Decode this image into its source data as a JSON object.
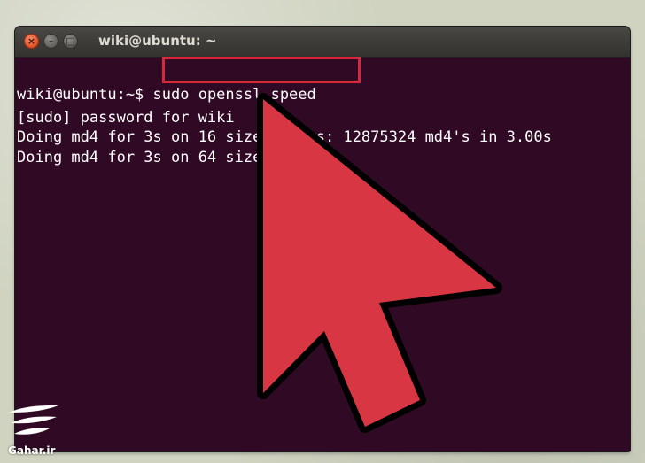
{
  "window": {
    "title": "wiki@ubuntu: ~",
    "close_glyph": "×",
    "minimize_glyph": "–",
    "maximize_glyph": "□"
  },
  "terminal": {
    "prompt": "wiki@ubuntu:~$ ",
    "command": "sudo openssl speed",
    "lines": [
      "[sudo] password for wiki",
      "Doing md4 for 3s on 16 size blocks: 12875324 md4's in 3.00s",
      "Doing md4 for 3s on 64 size blocks:"
    ]
  },
  "overlay": {
    "arrow_color": "#d93644",
    "highlight_color": "#d7283d",
    "arrow_icon": "mouse-pointer-arrow-icon"
  },
  "watermark": {
    "text": "Gahar.ir"
  },
  "colors": {
    "terminal_bg": "#300a24",
    "terminal_fg": "#ffffff",
    "titlebar_bg": "#3c3b37",
    "close_button": "#df4b1f"
  }
}
